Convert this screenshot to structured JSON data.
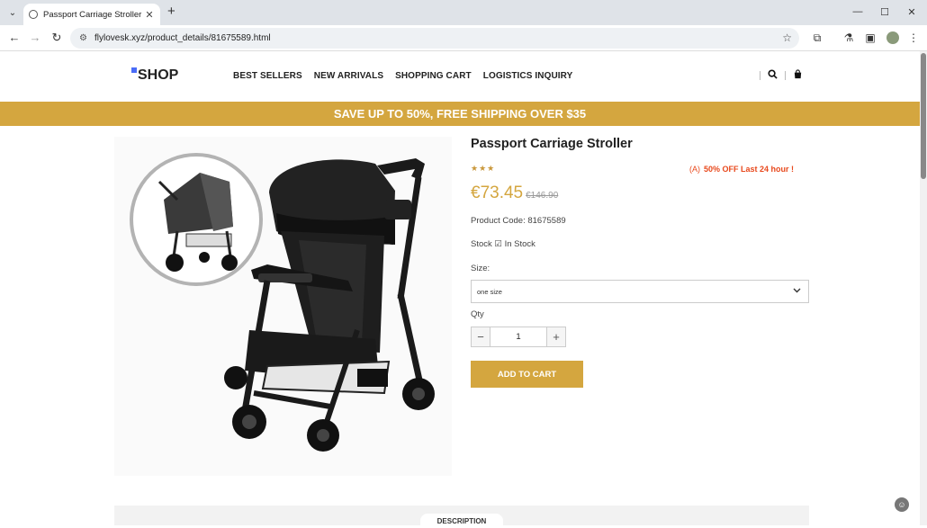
{
  "browser": {
    "tab_title": "Passport Carriage Stroller - On",
    "url": "flylovesk.xyz/product_details/81675589.html"
  },
  "site": {
    "logo": "SHOP",
    "nav": [
      "BEST SELLERS",
      "NEW ARRIVALS",
      "SHOPPING CART",
      "LOGISTICS INQUIRY"
    ]
  },
  "promo_banner": "SAVE UP TO 50%, FREE SHIPPING OVER $35",
  "product": {
    "title": "Passport Carriage Stroller",
    "rating": "★★★",
    "discount_tag": "50% OFF Last 24 hour !",
    "price": "€73.45",
    "old_price": "€146.90",
    "code_label": "Product Code: 81675589",
    "stock_label": "Stock",
    "stock_value": "In Stock",
    "size_label": "Size:",
    "size_value": "one size",
    "qty_label": "Qty",
    "qty_value": "1",
    "add_to_cart": "ADD TO CART"
  },
  "description_tab": "DESCRIPTION",
  "colors": {
    "accent": "#d4a63f",
    "sale": "#e8491d"
  },
  "icons": {
    "nav": [
      "back-arrow-icon",
      "forward-arrow-icon",
      "reload-icon"
    ],
    "header": [
      "search-icon",
      "shopping-bag-icon"
    ],
    "tag": "flash-sale-icon",
    "stock": "check-box-icon"
  }
}
